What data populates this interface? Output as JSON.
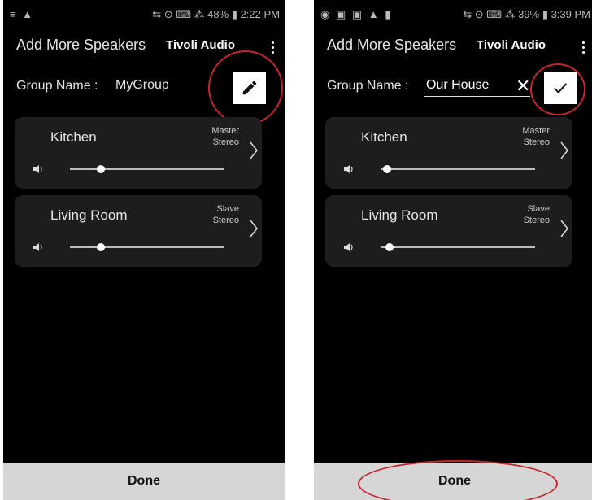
{
  "left": {
    "status": {
      "left_icons": "≡ ▲",
      "right": "⇆ ⊙ ⌨ ⁂ 48% ▮ 2:22 PM"
    },
    "appbar": {
      "title": "Add More Speakers",
      "brand": "Tivoli Audio"
    },
    "group": {
      "label": "Group Name :",
      "value": "MyGroup",
      "action_icon": "pencil-icon"
    },
    "speakers": [
      {
        "room": "Kitchen",
        "role_line1": "Master",
        "role_line2": "Stereo",
        "volume": 0.2
      },
      {
        "room": "Living Room",
        "role_line1": "Slave",
        "role_line2": "Stereo",
        "volume": 0.2
      }
    ],
    "done": "Done"
  },
  "right": {
    "status": {
      "left_icons": "◉ ▣ ▣ ▲ ▮",
      "right": "⇆ ⊙ ⌨ ⁂ 39% ▮ 3:39 PM"
    },
    "appbar": {
      "title": "Add More Speakers",
      "brand": "Tivoli Audio"
    },
    "group": {
      "label": "Group Name :",
      "value": "Our House",
      "clear": "✕",
      "action_icon": "check-icon"
    },
    "speakers": [
      {
        "room": "Kitchen",
        "role_line1": "Master",
        "role_line2": "Stereo",
        "volume": 0.04
      },
      {
        "room": "Living Room",
        "role_line1": "Slave",
        "role_line2": "Stereo",
        "volume": 0.06
      }
    ],
    "done": "Done"
  },
  "colors": {
    "background": "#000000",
    "card": "#1d1d1f",
    "done_bar": "#d6d6d6",
    "annotation": "#c8242b"
  }
}
